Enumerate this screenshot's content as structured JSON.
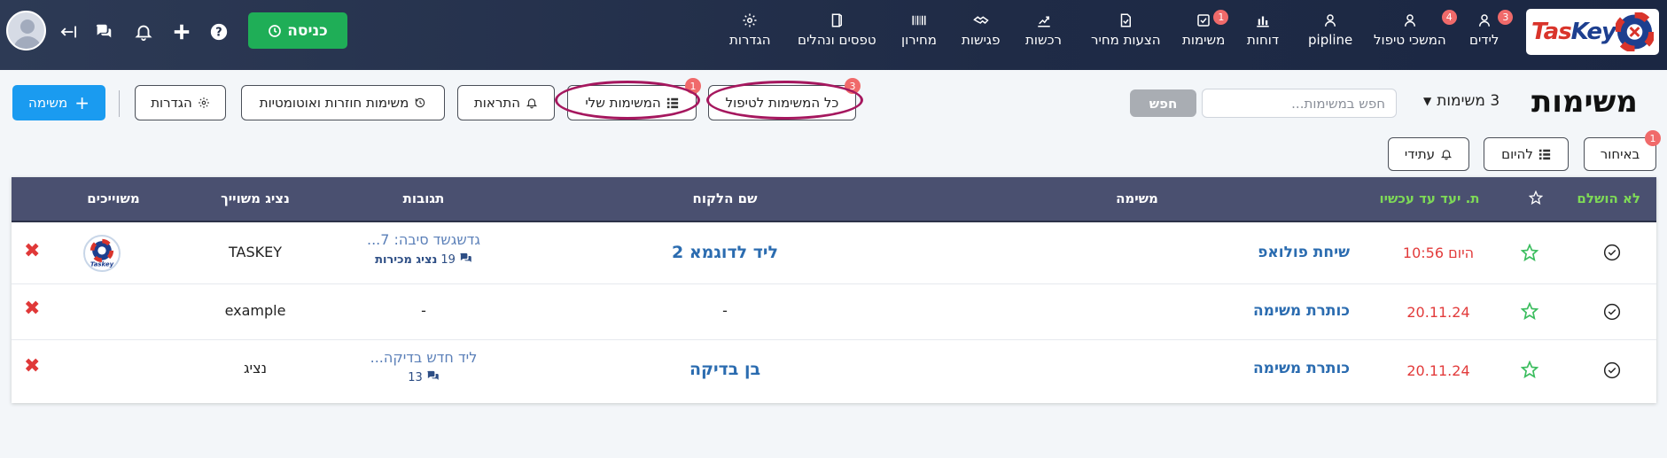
{
  "app": {
    "logo_text_main": "Tas",
    "logo_text_accent": "Key"
  },
  "header": {
    "enter_button_label": "כניסה",
    "nav": [
      {
        "id": "leads",
        "label": "לידים",
        "icon": "user-tie-icon",
        "badge": "3"
      },
      {
        "id": "handling",
        "label": "המשכי טיפול",
        "icon": "user-tie-icon",
        "badge": "4"
      },
      {
        "id": "pipeline",
        "label": "pipline",
        "icon": "user-tie-icon",
        "badge": ""
      },
      {
        "id": "reports",
        "label": "דוחות",
        "icon": "bar-chart-icon",
        "badge": ""
      },
      {
        "id": "tasks",
        "label": "משימות",
        "icon": "checkbox-icon",
        "badge": "1"
      },
      {
        "id": "quotes",
        "label": "הצעות מחיר",
        "icon": "document-icon",
        "badge": ""
      },
      {
        "id": "purchases",
        "label": "רכשות",
        "icon": "chart-up-icon",
        "badge": ""
      },
      {
        "id": "meetings",
        "label": "פגישות",
        "icon": "handshake-icon",
        "badge": ""
      },
      {
        "id": "pricelist",
        "label": "מחירון",
        "icon": "barcode-icon",
        "badge": ""
      },
      {
        "id": "forms",
        "label": "טפסים ונהלים",
        "icon": "door-icon",
        "badge": ""
      },
      {
        "id": "settings",
        "label": "הגדרות",
        "icon": "gear-icon",
        "badge": ""
      }
    ]
  },
  "toolbar": {
    "page_title": "משימות",
    "task_count_label": "3 משימות",
    "search_placeholder": "חפש במשימות...",
    "search_button": "חפש",
    "all_tasks_label": "כל המשימות לטיפול",
    "all_tasks_badge": "3",
    "my_tasks_label": "המשימות שלי",
    "my_tasks_badge": "1",
    "alerts_label": "התראות",
    "recurring_label": "משימות חוזרות ואוטומטיות",
    "settings_label": "הגדרות",
    "new_task_label": "משימה"
  },
  "filters": {
    "late_label": "באיחור",
    "late_badge": "1",
    "today_label": "להיום",
    "future_label": "עתידי"
  },
  "table": {
    "headers": {
      "not_done": "לא הושלם",
      "star": "",
      "due": "ת. יעד עד עכשיו",
      "task": "משימה",
      "client": "שם הלקוח",
      "replies": "תגובות",
      "assigned_rep": "נציג משוייך",
      "assignees": "משוייכים"
    },
    "rows": [
      {
        "due": "היום 10:56",
        "task": "שיחת פולואפ",
        "client": "ליד לדוגמא 2",
        "reply_text": "גדשגשד סיבה: 7...",
        "reply_count": "19",
        "reply_author": "נציג מכירות",
        "rep": "TASKEY",
        "assignee_logo": "Taskey"
      },
      {
        "due": "20.11.24",
        "task": "כותרת משימה",
        "client": "-",
        "reply_text": "-",
        "reply_count": "",
        "reply_author": "",
        "rep": "example",
        "assignee_logo": ""
      },
      {
        "due": "20.11.24",
        "task": "כותרת משימה",
        "client": "בן בדיקה",
        "reply_text": "ליד חדש בדיקה...",
        "reply_count": "13",
        "reply_author": "",
        "rep": "נציג",
        "assignee_logo": ""
      }
    ]
  },
  "colors": {
    "navbar": "#1f2b46",
    "enter_button": "#1fae57",
    "new_task_button": "#1a9bf0",
    "badge": "#f06a6a",
    "header_row": "#4a5070",
    "highlight_ring": "#a5175e",
    "due_date": "#e23b3b",
    "link": "#2b6cb0"
  }
}
